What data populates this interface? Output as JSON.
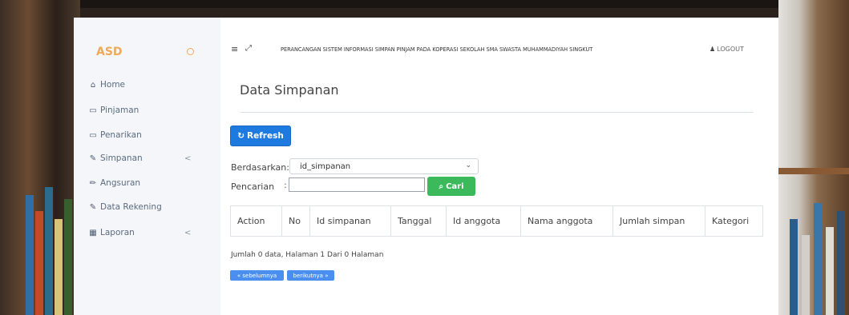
{
  "sidebar": {
    "brand": "ASD",
    "items": [
      {
        "label": "Home",
        "icon": "home-icon",
        "glyph": "⌂"
      },
      {
        "label": "Pinjaman",
        "icon": "credit-card-icon",
        "glyph": "▭"
      },
      {
        "label": "Penarikan",
        "icon": "credit-card-icon",
        "glyph": "▭"
      },
      {
        "label": "Simpanan",
        "icon": "edit-icon",
        "glyph": "✎",
        "chevron": "<"
      },
      {
        "label": "Angsuran",
        "icon": "pencil-icon",
        "glyph": "✏"
      },
      {
        "label": "Data Rekening",
        "icon": "edit-icon",
        "glyph": "✎"
      },
      {
        "label": "Laporan",
        "icon": "calendar-icon",
        "glyph": "▦",
        "chevron": "<"
      }
    ]
  },
  "header": {
    "app_title": "PERANCANGAN SISTEM INFORMASI SIMPAN PINJAM PADA KOPERASI SEKOLAH SMA SWASTA MUHAMMADIYAH SINGKUT",
    "logout": "LOGOUT"
  },
  "main": {
    "title": "Data Simpanan",
    "refresh_label": "Refresh",
    "filter_label": "Berdasarkan:",
    "filter_value": "id_simpanan",
    "search_label": "Pencarian",
    "search_value": "",
    "search_button": "Cari",
    "table_headers": [
      "Action",
      "No",
      "Id simpanan",
      "Tanggal",
      "Id anggota",
      "Nama anggota",
      "Jumlah simpan",
      "Kategori"
    ],
    "summary": "Jumlah 0 data, Halaman 1 Dari 0 Halaman",
    "prev_label": "« sebelumnya",
    "next_label": "berikutnya »"
  },
  "colors": {
    "brand": "#f0a958",
    "primary": "#1f7ae0",
    "success": "#3cb95b",
    "sidebar_bg": "#f4f6f9"
  }
}
